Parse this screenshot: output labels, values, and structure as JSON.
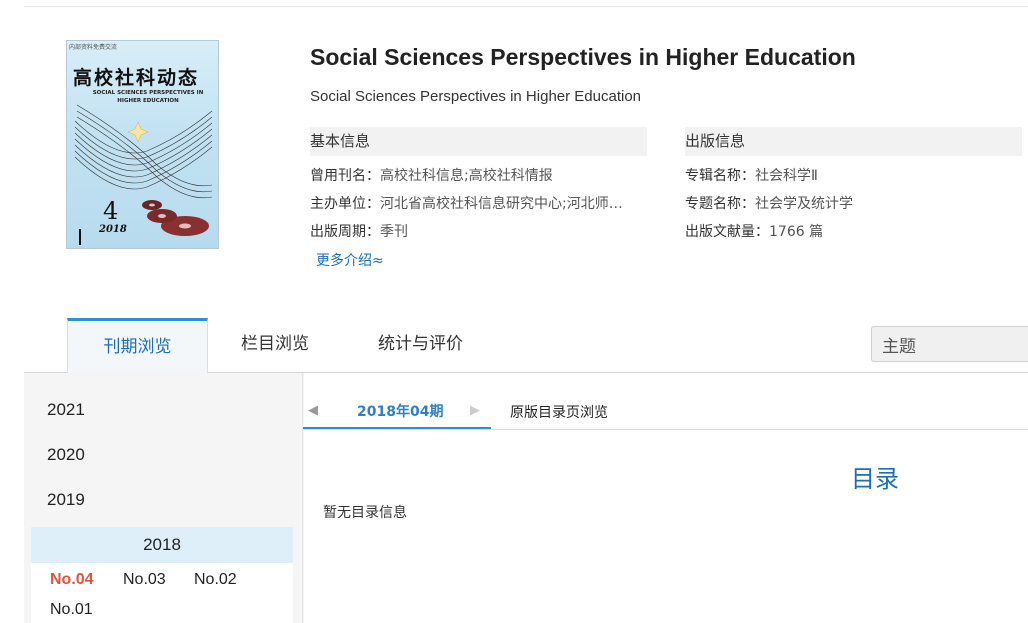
{
  "cover": {
    "top_text": "内部资料免费交流",
    "title": "高校社科动态",
    "subtitle": "SOCIAL SCIENCES PERSPECTIVES IN HIGHER EDUCATION",
    "issue_number": "4",
    "year": "2018"
  },
  "journal": {
    "title": "Social Sciences Perspectives in Higher Education",
    "subtitle": "Social Sciences Perspectives in Higher Education"
  },
  "basic_info": {
    "heading": "基本信息",
    "rows": [
      {
        "key": "曾用刊名：",
        "value": "高校社科信息;高校社科情报"
      },
      {
        "key": "主办单位：",
        "value": "河北省高校社科信息研究中心;河北师…"
      },
      {
        "key": "出版周期：",
        "value": "季刊"
      }
    ],
    "more_label": "更多介绍≈"
  },
  "publish_info": {
    "heading": "出版信息",
    "rows": [
      {
        "key": "专辑名称：",
        "value": "社会科学Ⅱ"
      },
      {
        "key": "专题名称：",
        "value": "社会学及统计学"
      },
      {
        "key": "出版文献量：",
        "value": "1766 篇"
      }
    ]
  },
  "tabs": [
    {
      "label": "刊期浏览",
      "active": true
    },
    {
      "label": "栏目浏览",
      "active": false
    },
    {
      "label": "统计与评价",
      "active": false
    }
  ],
  "search": {
    "value": "主题"
  },
  "sidebar": {
    "years": [
      "2021",
      "2020",
      "2019"
    ],
    "active_year": "2018",
    "issues": [
      "No.04",
      "No.03",
      "No.02",
      "No.01"
    ],
    "selected_issue": "No.04"
  },
  "main": {
    "prev_arrow": "◀",
    "next_arrow": "▶",
    "issue_label": "2018年04期",
    "original_toc_label": "原版目录页浏览",
    "toc_title": "目录",
    "toc_empty": "暂无目录信息"
  },
  "colors": {
    "accent": "#2f8fd6",
    "link": "#1a6fb5",
    "selected_issue": "#e0533d",
    "active_year_bg": "#dfeffa"
  }
}
